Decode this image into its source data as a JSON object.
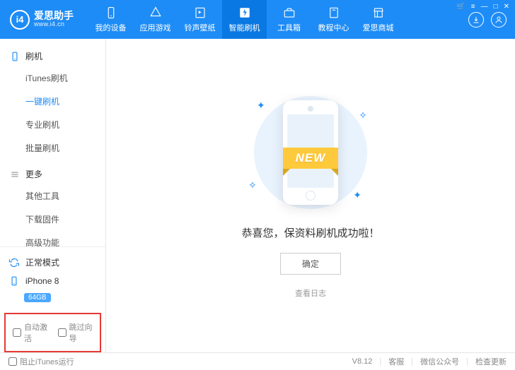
{
  "brand": {
    "name": "爱思助手",
    "url": "www.i4.cn",
    "mark": "i4"
  },
  "nav": [
    {
      "label": "我的设备",
      "icon": "phone"
    },
    {
      "label": "应用游戏",
      "icon": "apps"
    },
    {
      "label": "铃声壁纸",
      "icon": "music"
    },
    {
      "label": "智能刷机",
      "icon": "flash",
      "active": true
    },
    {
      "label": "工具箱",
      "icon": "toolbox"
    },
    {
      "label": "教程中心",
      "icon": "book"
    },
    {
      "label": "爱思商城",
      "icon": "store"
    }
  ],
  "sidebar": {
    "group1": {
      "title": "刷机",
      "items": [
        "iTunes刷机",
        "一键刷机",
        "专业刷机",
        "批量刷机"
      ],
      "activeIndex": 1
    },
    "group2": {
      "title": "更多",
      "items": [
        "其他工具",
        "下载固件",
        "高级功能"
      ]
    },
    "mode": "正常模式",
    "device": {
      "name": "iPhone 8",
      "storage": "64GB"
    },
    "checks": {
      "autoActivate": "自动激活",
      "skipWizard": "跳过向导"
    }
  },
  "main": {
    "ribbon": "NEW",
    "message": "恭喜您，保资料刷机成功啦！",
    "ok": "确定",
    "log": "查看日志"
  },
  "footer": {
    "blockItunes": "阻止iTunes运行",
    "version": "V8.12",
    "support": "客服",
    "wechat": "微信公众号",
    "update": "检查更新"
  }
}
